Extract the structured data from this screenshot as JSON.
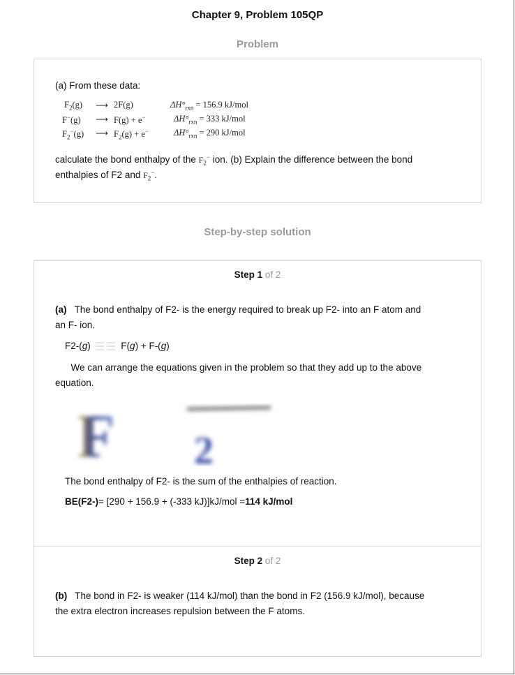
{
  "page_title": "Chapter 9, Problem 105QP",
  "problem_heading": "Problem",
  "problem": {
    "intro": "(a) From these data:",
    "equations": [
      {
        "lhs": "F",
        "lhs_sub": "2",
        "lhs_rest": "(g)",
        "rhs": "2F(g)",
        "dh_label": "ΔH°",
        "dh_sub": "rxn",
        "dh_value": "= 156.9 kJ/mol"
      },
      {
        "lhs": "F",
        "lhs_sup": "−",
        "lhs_rest": "(g)",
        "rhs": "F(g) + e",
        "rhs_sup": "−",
        "dh_label": "ΔH°",
        "dh_sub": "rxn",
        "dh_value": "= 333 kJ/mol"
      },
      {
        "lhs": "F",
        "lhs_sub": "2",
        "lhs_sup": "−",
        "lhs_rest": "(g)",
        "rhs": "F",
        "rhs_sub": "2",
        "rhs_rest": "(g) + e",
        "rhs_sup": "−",
        "dh_label": "ΔH°",
        "dh_sub": "rxn",
        "dh_value": "= 290 kJ/mol"
      }
    ],
    "question_part1": "calculate the bond enthalpy of the",
    "question_ion": "F",
    "question_part2": "ion. (b) Explain the difference between the bond",
    "question_line2": "enthalpies of F2 and",
    "question_ion2": "F"
  },
  "solution_heading": "Step-by-step solution",
  "step1": {
    "label_bold": "Step 1",
    "label_of": "of 2",
    "para1_tag": "(a)",
    "para1_line1": "The bond enthalpy of F2- is the energy required to break up F2- into an F atom and",
    "para1_line2": "an F- ion.",
    "reaction_lhs": "F2-(",
    "reaction_g": "g",
    "reaction_lhs_end": ")",
    "reaction_rhs_a": "F(",
    "reaction_rhs_g1": "g",
    "reaction_rhs_b": ") + F-(",
    "reaction_rhs_g2": "g",
    "reaction_rhs_c": ")",
    "para2_line1": "We can arrange the equations given in the problem so that they add up to the above",
    "para2_line2": "equation.",
    "image_text": "F",
    "image_sub": "2",
    "para3": "The bond enthalpy of F2- is the sum of the enthalpies of reaction.",
    "be_label": "BE(F2-)",
    "be_expr": "= [290 + 156.9 + (-333 kJ)]kJ/mol =",
    "be_result": "114 kJ/mol"
  },
  "step2": {
    "label_bold": "Step 2",
    "label_of": "of 2",
    "para_tag": "(b)",
    "para_line1": "The bond in F2- is weaker (114 kJ/mol) than the bond in F2 (156.9 kJ/mol), because",
    "para_line2": "the extra electron increases repulsion between the F atoms."
  },
  "colors": {
    "heading_gray": "#9a9a9a",
    "border": "#d6d6d6",
    "text": "#111111"
  }
}
